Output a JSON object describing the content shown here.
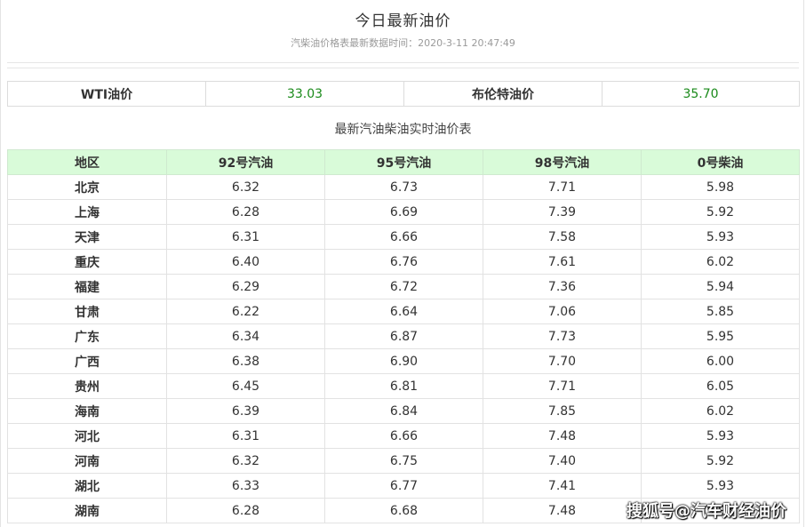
{
  "header": {
    "title": "今日最新油价",
    "subtitle": "汽柴油价格表最新数据时间：2020-3-11 20:47:49"
  },
  "crude": {
    "wti_label": "WTI油价",
    "wti_value": "33.03",
    "brent_label": "布伦特油价",
    "brent_value": "35.70"
  },
  "table": {
    "caption": "最新汽油柴油实时油价表",
    "columns": [
      "地区",
      "92号汽油",
      "95号汽油",
      "98号汽油",
      "0号柴油"
    ],
    "rows": [
      [
        "北京",
        "6.32",
        "6.73",
        "7.71",
        "5.98"
      ],
      [
        "上海",
        "6.28",
        "6.69",
        "7.39",
        "5.92"
      ],
      [
        "天津",
        "6.31",
        "6.66",
        "7.58",
        "5.93"
      ],
      [
        "重庆",
        "6.40",
        "6.76",
        "7.61",
        "6.02"
      ],
      [
        "福建",
        "6.29",
        "6.72",
        "7.36",
        "5.94"
      ],
      [
        "甘肃",
        "6.22",
        "6.64",
        "7.06",
        "5.85"
      ],
      [
        "广东",
        "6.34",
        "6.87",
        "7.73",
        "5.95"
      ],
      [
        "广西",
        "6.38",
        "6.90",
        "7.70",
        "6.00"
      ],
      [
        "贵州",
        "6.45",
        "6.81",
        "7.71",
        "6.05"
      ],
      [
        "海南",
        "6.39",
        "6.84",
        "7.85",
        "6.02"
      ],
      [
        "河北",
        "6.31",
        "6.66",
        "7.48",
        "5.93"
      ],
      [
        "河南",
        "6.32",
        "6.75",
        "7.40",
        "5.92"
      ],
      [
        "湖北",
        "6.33",
        "6.77",
        "7.41",
        "5.93"
      ],
      [
        "湖南",
        "6.28",
        "6.68",
        "7.48",
        "5.93"
      ]
    ]
  },
  "watermark": "搜狐号@汽车财经油价",
  "colors": {
    "header_bg": "#d9fbd9",
    "value_green": "#1a8a1a"
  }
}
